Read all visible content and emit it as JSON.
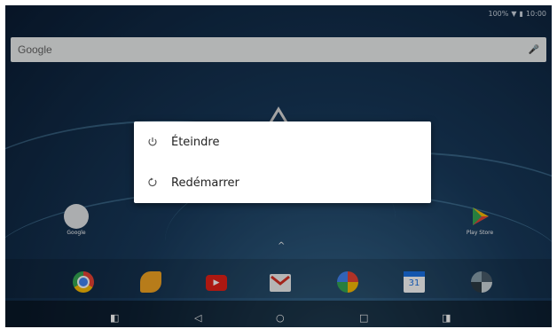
{
  "status": {
    "battery": "100%",
    "time": "10:00"
  },
  "search": {
    "brand": "Google"
  },
  "power_menu": {
    "items": [
      {
        "label": "Éteindre",
        "icon": "power-icon"
      },
      {
        "label": "Redémarrer",
        "icon": "restart-icon"
      }
    ]
  },
  "home_apps": {
    "left_label": "Google",
    "right_label": "Play Store"
  },
  "dock": {
    "apps": [
      "chrome-icon",
      "music-icon",
      "youtube-icon",
      "gmail-icon",
      "photos-icon",
      "calendar-icon",
      "camera-icon"
    ],
    "calendar_day": "31"
  },
  "nav": {
    "buttons": [
      "volume-down-icon",
      "back-icon",
      "home-icon",
      "recents-icon",
      "volume-up-icon"
    ]
  },
  "colors": {
    "dialog_bg": "#ffffff",
    "accent": "#1a73e8"
  }
}
